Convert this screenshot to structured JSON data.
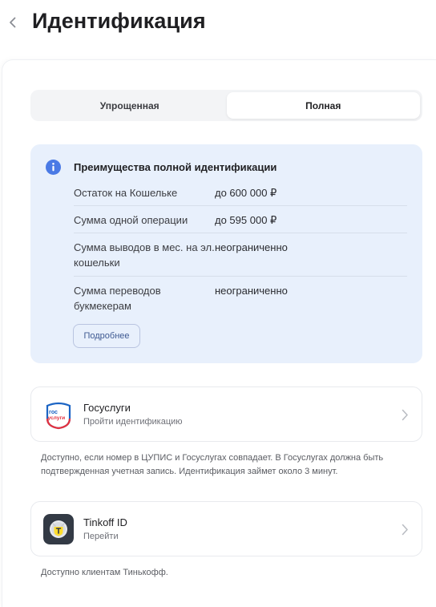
{
  "header": {
    "title": "Идентификация",
    "back_icon": "chevron-left-icon"
  },
  "tabs": [
    {
      "label": "Упрощенная",
      "active": false
    },
    {
      "label": "Полная",
      "active": true
    }
  ],
  "info": {
    "icon": "info-icon",
    "title": "Преимущества полной идентификации",
    "rows": [
      {
        "label": "Остаток на Кошельке",
        "value": "до 600 000 ₽"
      },
      {
        "label": "Сумма одной операции",
        "value": "до 595 000 ₽"
      },
      {
        "label": "Сумма выводов в мес. на эл. кошельки",
        "value": "неограниченно"
      },
      {
        "label": "Сумма переводов букмекерам",
        "value": "неограниченно"
      }
    ],
    "more_label": "Подробнее"
  },
  "options": {
    "gosuslugi": {
      "logo_icon": "gosuslugi-logo-icon",
      "logo_text_top": "гос",
      "logo_text_bottom": "услуги",
      "title": "Госуслуги",
      "subtitle": "Пройти идентификацию",
      "note": "Доступно, если номер в ЦУПИС и Госуслугах совпадает. В Госуслугах должна быть подтвержденная учетная запись. Идентификация займет около 3 минут."
    },
    "tinkoff": {
      "logo_icon": "tinkoff-logo-icon",
      "title": "Tinkoff ID",
      "subtitle": "Перейти",
      "note": "Доступно клиентам Тинькофф."
    }
  },
  "colors": {
    "accent_blue": "#4a7ae5",
    "info_bg": "#e8f0fc",
    "tinkoff_yellow": "#ffdd2d",
    "tinkoff_dark": "#333a45",
    "gos_red": "#e4313e",
    "gos_blue": "#1b64c4"
  }
}
